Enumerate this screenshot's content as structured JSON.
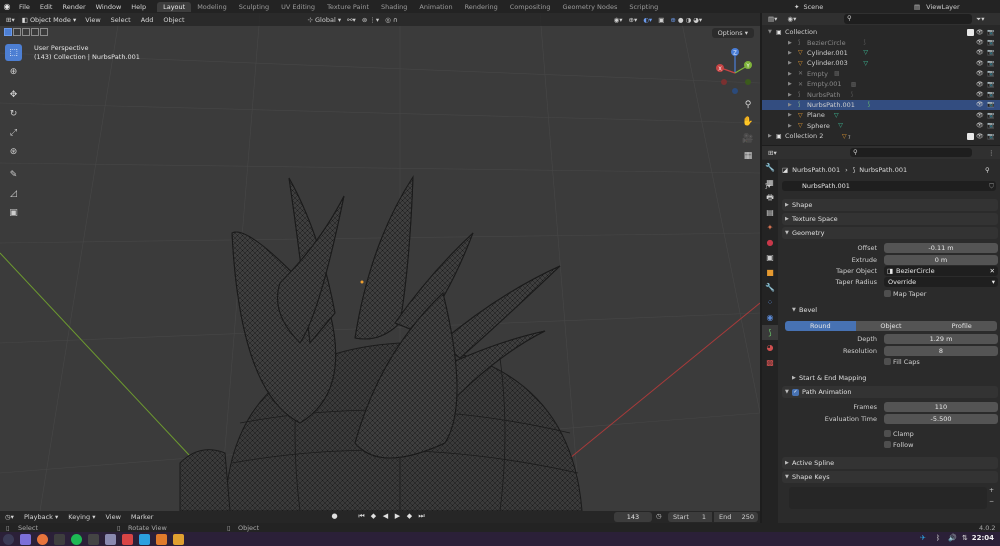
{
  "topbar": {
    "menus": [
      "File",
      "Edit",
      "Render",
      "Window",
      "Help"
    ],
    "workspaces": [
      "Layout",
      "Modeling",
      "Sculpting",
      "UV Editing",
      "Texture Paint",
      "Shading",
      "Animation",
      "Rendering",
      "Compositing",
      "Geometry Nodes",
      "Scripting"
    ],
    "active_workspace": "Layout",
    "scene": "Scene",
    "view_layer": "ViewLayer"
  },
  "viewport": {
    "mode": "Object Mode",
    "menus": [
      "View",
      "Select",
      "Add",
      "Object"
    ],
    "orientation": "Global",
    "options": "Options",
    "view_name": "User Perspective",
    "view_context": "(143) Collection | NurbsPath.001",
    "gizmo": {
      "x": "X",
      "y": "Y",
      "z": "Z"
    }
  },
  "timeline": {
    "menus": [
      "Playback",
      "Keying",
      "View",
      "Marker"
    ],
    "current_frame": "143",
    "start_label": "Start",
    "start": "1",
    "end_label": "End",
    "end": "250"
  },
  "status": {
    "select": "Select",
    "rotate": "Rotate View",
    "object": "Object",
    "version": "4.0.2"
  },
  "outliner": {
    "rows": [
      {
        "name": "Collection",
        "kind": "collection",
        "dim": false,
        "selected": false
      },
      {
        "name": "BezierCircle",
        "kind": "curve",
        "dim": true,
        "selected": false
      },
      {
        "name": "Cylinder.001",
        "kind": "mesh",
        "dim": false,
        "selected": false
      },
      {
        "name": "Cylinder.003",
        "kind": "mesh",
        "dim": false,
        "selected": false
      },
      {
        "name": "Empty",
        "kind": "empty",
        "dim": true,
        "selected": false
      },
      {
        "name": "Empty.001",
        "kind": "empty",
        "dim": true,
        "selected": false
      },
      {
        "name": "NurbsPath",
        "kind": "curve",
        "dim": true,
        "selected": false
      },
      {
        "name": "NurbsPath.001",
        "kind": "curve",
        "dim": false,
        "selected": true
      },
      {
        "name": "Plane",
        "kind": "mesh",
        "dim": false,
        "selected": false
      },
      {
        "name": "Sphere",
        "kind": "mesh",
        "dim": false,
        "selected": false
      },
      {
        "name": "Collection 2",
        "kind": "collection",
        "dim": false,
        "selected": false
      }
    ],
    "collection2_badge": "7"
  },
  "properties": {
    "breadcrumb_object": "NurbsPath.001",
    "breadcrumb_data": "NurbsPath.001",
    "data_name": "NurbsPath.001",
    "panels": {
      "shape": "Shape",
      "texture_space": "Texture Space",
      "geometry": "Geometry",
      "bevel": "Bevel",
      "start_end": "Start & End Mapping",
      "path_animation": "Path Animation",
      "active_spline": "Active Spline",
      "shape_keys": "Shape Keys"
    },
    "geometry": {
      "offset_label": "Offset",
      "offset": "-0.11 m",
      "extrude_label": "Extrude",
      "extrude": "0 m",
      "taper_object_label": "Taper Object",
      "taper_object": "BezierCircle",
      "taper_radius_label": "Taper Radius",
      "taper_radius": "Override",
      "map_taper": "Map Taper"
    },
    "bevel": {
      "modes": [
        "Round",
        "Object",
        "Profile"
      ],
      "active_mode": "Round",
      "depth_label": "Depth",
      "depth": "1.29 m",
      "resolution_label": "Resolution",
      "resolution": "8",
      "fill_caps": "Fill Caps"
    },
    "path_animation": {
      "frames_label": "Frames",
      "frames": "110",
      "eval_label": "Evaluation Time",
      "eval_time": "-5.500",
      "clamp": "Clamp",
      "follow": "Follow"
    }
  },
  "taskbar": {
    "clock": "22:04"
  }
}
